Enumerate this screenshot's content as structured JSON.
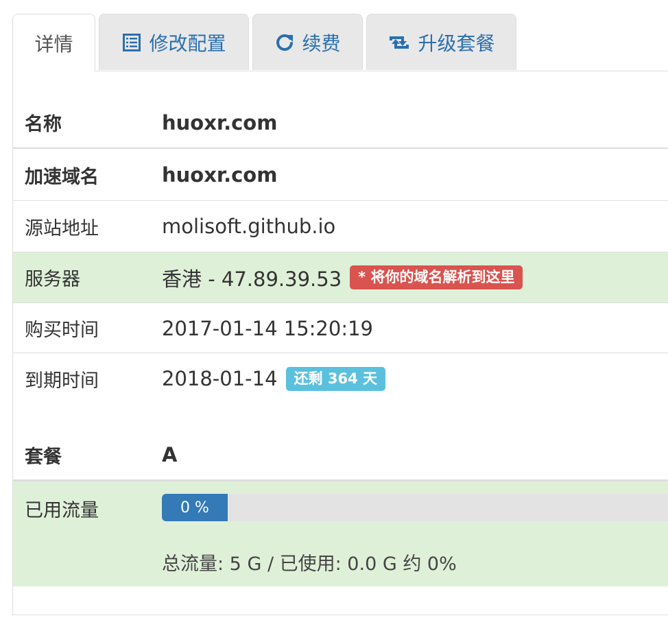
{
  "tabs": [
    {
      "label": "详情",
      "icon": "none",
      "active": true
    },
    {
      "label": "修改配置",
      "icon": "list-icon",
      "active": false
    },
    {
      "label": "续费",
      "icon": "refresh-icon",
      "active": false
    },
    {
      "label": "升级套餐",
      "icon": "retweet-icon",
      "active": false
    }
  ],
  "details": {
    "name": {
      "key": "名称",
      "value": "huoxr.com"
    },
    "domain": {
      "key": "加速域名",
      "value": "huoxr.com"
    },
    "origin": {
      "key": "源站地址",
      "value": "molisoft.github.io"
    },
    "server": {
      "key": "服务器",
      "value": "香港 - 47.89.39.53",
      "badge": "* 将你的域名解析到这里"
    },
    "purchase_time": {
      "key": "购买时间",
      "value": "2017-01-14 15:20:19"
    },
    "expire_time": {
      "key": "到期时间",
      "value": "2018-01-14",
      "badge": "还剩 364 天"
    },
    "plan": {
      "key": "套餐",
      "value": "A"
    },
    "traffic": {
      "key": "已用流量",
      "progress_label": "0 %",
      "progress_percent": 0,
      "note": "总流量: 5 G / 已使用: 0.0 G 约 0%"
    }
  },
  "colors": {
    "tab_link": "#2a6fae",
    "success_row": "#dff0d8",
    "danger_badge": "#d9534f",
    "info_badge": "#5bc0de",
    "progress_bar": "#337ab7"
  }
}
